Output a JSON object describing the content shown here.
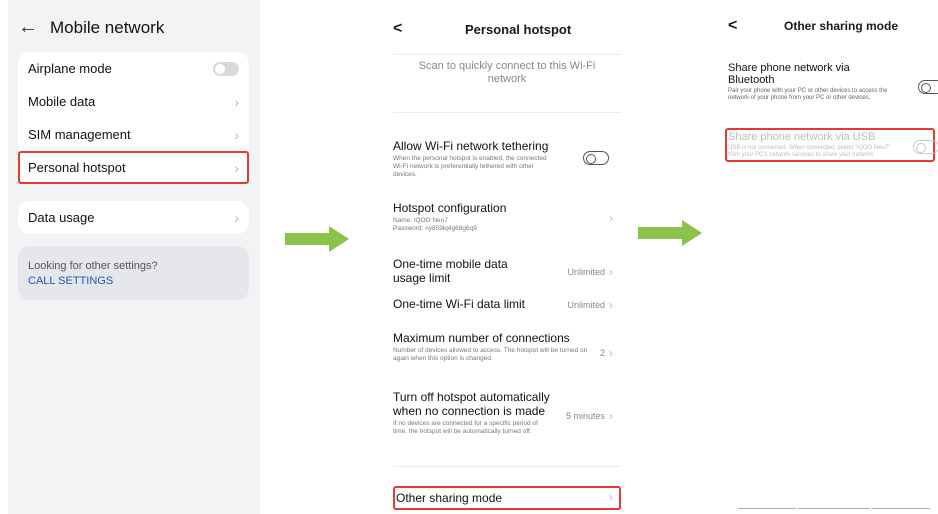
{
  "panel1": {
    "back_icon": "back-arrow-icon",
    "title": "Mobile network",
    "items": [
      {
        "label": "Airplane mode"
      },
      {
        "label": "Mobile data"
      },
      {
        "label": "SIM management"
      },
      {
        "label": "Personal hotspot"
      }
    ],
    "data_usage": "Data usage",
    "other_settings_prompt": "Looking for other settings?",
    "call_settings": "CALL SETTINGS"
  },
  "arrow_color": "#8bc34a",
  "highlight_color": "#e53935",
  "panel2": {
    "title": "Personal hotspot",
    "scan_text": "Scan to quickly connect to this Wi-Fi network",
    "tethering_title": "Allow Wi-Fi network tethering",
    "tethering_desc": "When the personal hotspot is enabled, the connected Wi-Fi network is preferentially tethered with other devices.",
    "config_title": "Hotspot configuration",
    "config_name": "Name: iQOO Neo7",
    "config_password": "Password: ny859lq4g68g6q9",
    "mobile_limit_title": "One-time mobile data usage limit",
    "mobile_limit_value": "Unlimited",
    "wifi_limit_title": "One-time Wi-Fi data limit",
    "wifi_limit_value": "Unlimited",
    "max_conn_title": "Maximum number of connections",
    "max_conn_desc": "Number of devices allowed to access. The hotspot will be turned on again when this option is changed.",
    "max_conn_value": "2",
    "auto_off_title": "Turn off hotspot automatically when no connection is made",
    "auto_off_desc": "If no devices are connected for a specific period of time, the hotspot will be automatically turned off.",
    "auto_off_value": "5 minutes",
    "other_sharing": "Other sharing mode"
  },
  "panel3": {
    "title": "Other sharing mode",
    "bt_title": "Share phone network via Bluetooth",
    "bt_desc": "Pair your phone with your PC or other devices to access the network of your phone from your PC or other devices.",
    "usb_title": "Share phone network via USB",
    "usb_desc": "USB is not connected. When connected, select \"iQOO Neo7\" from your PC's network services to share your network."
  }
}
